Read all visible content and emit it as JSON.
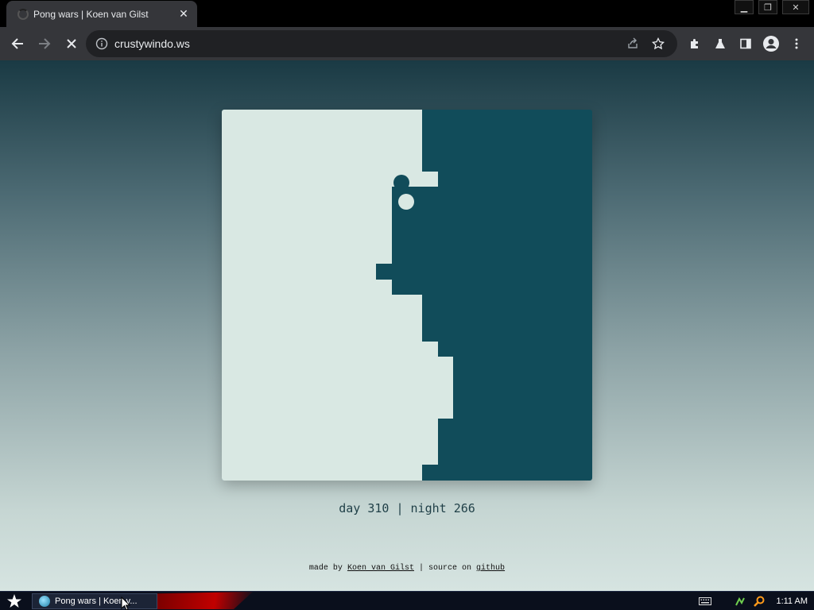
{
  "browser": {
    "tab_title": "Pong wars | Koen van Gilst",
    "url": "crustywindo.ws",
    "icons": {
      "back": "back-arrow-icon",
      "forward": "forward-arrow-icon",
      "stop": "stop-loading-icon",
      "site_info": "info-icon",
      "share": "share-icon",
      "bookmark": "star-icon",
      "extensions": "puzzle-icon",
      "labs": "flask-icon",
      "side_panel": "side-panel-icon",
      "profile": "profile-icon",
      "menu": "kebab-menu-icon"
    }
  },
  "game": {
    "colors": {
      "day": "#D9E8E3",
      "night": "#114C5A"
    },
    "score": {
      "day_label": "day",
      "day_value": "310",
      "separator": "|",
      "night_label": "night",
      "night_value": "266"
    }
  },
  "footer": {
    "made_by_prefix": "made by",
    "author_link": "Koen van Gilst",
    "separator": "|",
    "source_prefix": "source on",
    "source_link": "github"
  },
  "taskbar": {
    "task_label": "Pong wars | Koen v...",
    "clock": "1:11 AM",
    "icons": {
      "start": "star-icon",
      "keyboard": "keyboard-icon",
      "network": "network-icon",
      "search": "search-icon"
    }
  }
}
